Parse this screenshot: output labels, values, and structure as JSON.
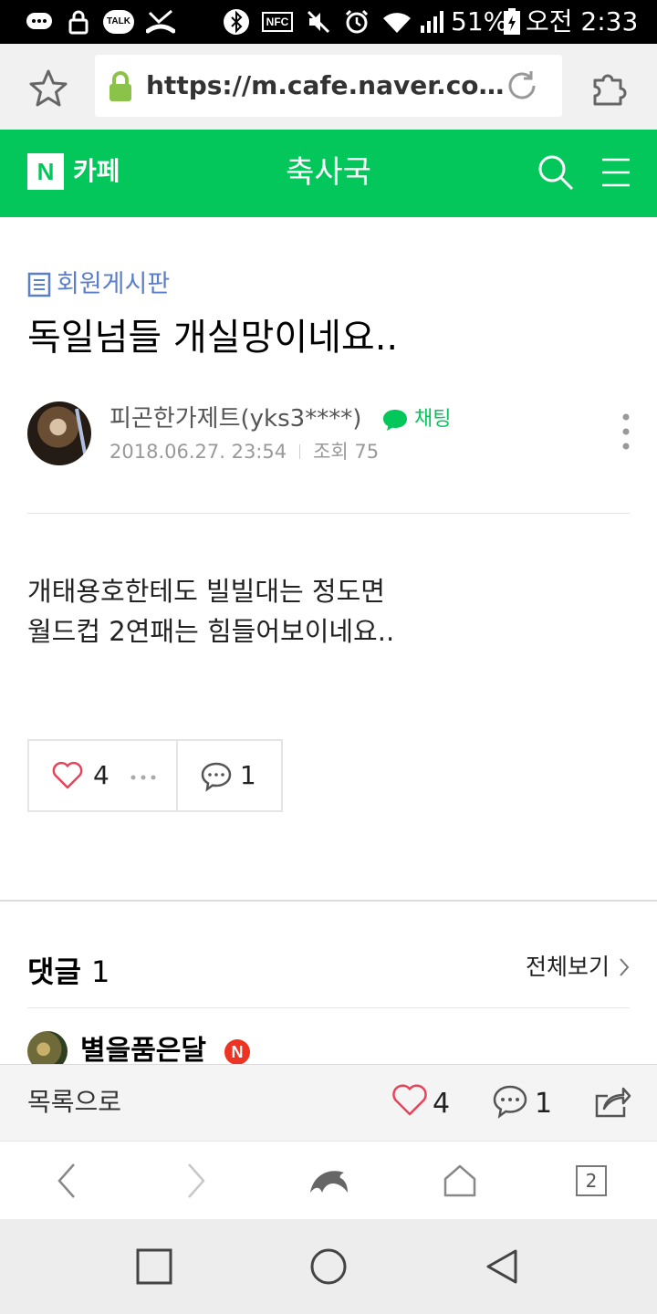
{
  "status_bar": {
    "talk_label": "TALK",
    "nfc_label": "NFC",
    "battery": "51%",
    "time": "오전 2:33"
  },
  "browser": {
    "url": "https://m.cafe.naver.co…"
  },
  "header": {
    "logo_letter": "N",
    "cafe_label": "카페",
    "title": "축사국"
  },
  "post": {
    "board": "회원게시판",
    "title": "독일넘들 개실망이네요..",
    "author": "피곤한가제트(yks3****)",
    "chat_label": "채팅",
    "date": "2018.06.27. 23:54",
    "views": "조회 75",
    "body_lines": [
      "개태용호한테도 빌빌대는 정도면",
      "월드컵 2연패는 힘들어보이네요.."
    ],
    "like_count": "4",
    "comment_count": "1"
  },
  "comments": {
    "label": "댓글",
    "count": "1",
    "view_all": "전체보기",
    "first_author": "별을품은달",
    "badge": "N"
  },
  "action_bar": {
    "back_label": "목록으로",
    "like_count": "4",
    "comment_count": "1"
  },
  "nav": {
    "tab_count": "2"
  },
  "colors": {
    "brand_green": "#03c75a",
    "board_blue": "#5b7ec9",
    "like_red": "#e8435a",
    "badge_red": "#ee3322"
  }
}
